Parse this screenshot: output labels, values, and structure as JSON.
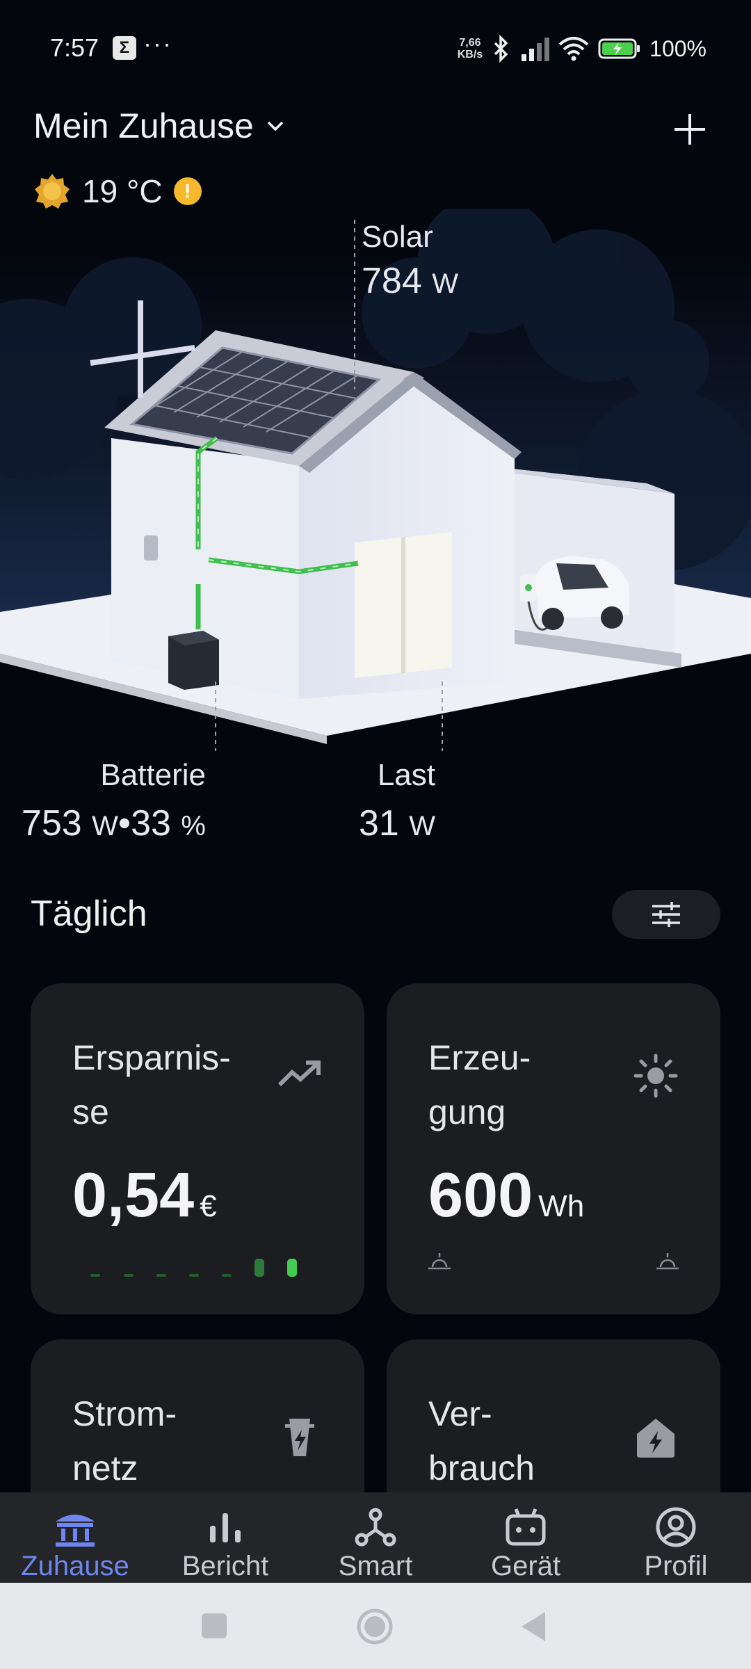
{
  "status": {
    "time": "7:57",
    "sigma": "Σ",
    "dots": "···",
    "net_speed_top": "7,66",
    "net_speed_bottom": "KB/s",
    "battery_pct": "100%"
  },
  "header": {
    "title": "Mein Zuhause"
  },
  "weather": {
    "temperature": "19 °C",
    "warning": "!"
  },
  "flows": {
    "solar": {
      "name": "Solar",
      "value": "784",
      "unit": "W"
    },
    "battery": {
      "name": "Batterie",
      "value": "753",
      "unit1": "W",
      "sep": "•",
      "pct": "33",
      "unit2": "%"
    },
    "load": {
      "name": "Last",
      "value": "31",
      "unit": "W"
    }
  },
  "section": {
    "title": "Täglich"
  },
  "cards": [
    {
      "title": "Ersparnis-se",
      "title_l1": "Ersparnis-",
      "title_l2": "se",
      "value": "0,54",
      "unit": "€",
      "icon": "trend-up-icon"
    },
    {
      "title": "Erzeu-gung",
      "title_l1": "Erzeu-",
      "title_l2": "gung",
      "value": "600",
      "unit": "Wh",
      "icon": "sun-icon"
    },
    {
      "title": "Strom-netz",
      "title_l1": "Strom-",
      "title_l2": "netz",
      "icon": "power-tower-icon"
    },
    {
      "title": "Ver-brauch",
      "title_l1": "Ver-",
      "title_l2": "brauch",
      "icon": "house-bolt-icon"
    }
  ],
  "nav": [
    {
      "label": "Zuhause",
      "icon": "home-icon",
      "active": true
    },
    {
      "label": "Bericht",
      "icon": "bar-chart-icon",
      "active": false
    },
    {
      "label": "Smart",
      "icon": "smart-nodes-icon",
      "active": false
    },
    {
      "label": "Gerät",
      "icon": "device-icon",
      "active": false
    },
    {
      "label": "Profil",
      "icon": "profile-icon",
      "active": false
    }
  ],
  "colors": {
    "accent": "#6f86f0",
    "flow_green": "#3fbf4d",
    "card_bg": "#1c1d21",
    "warning": "#f6b92c"
  }
}
